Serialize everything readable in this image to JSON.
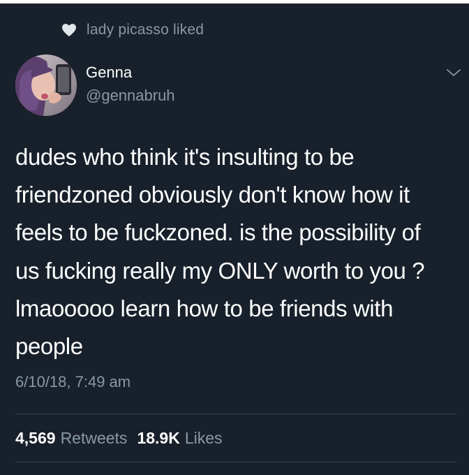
{
  "social_context": {
    "icon": "heart-icon",
    "text": "lady picasso liked"
  },
  "author": {
    "display_name": "Genna",
    "handle": "@gennabruh"
  },
  "tweet": {
    "lines": [
      "dudes who think it's insulting to be",
      "friendzoned obviously don't know how it",
      "feels to be fuckzoned. is the possibility of",
      "us fucking really my ONLY worth to you ?",
      "lmaooooo learn how to be friends with",
      "people"
    ],
    "timestamp": "6/10/18, 7:49 am"
  },
  "stats": {
    "retweets_count": "4,569",
    "retweets_label": "Retweets",
    "likes_count": "18.9K",
    "likes_label": "Likes"
  },
  "colors": {
    "background": "#18202b",
    "text_primary": "#ffffff",
    "text_secondary": "#8899a6",
    "divider": "#38444d"
  }
}
